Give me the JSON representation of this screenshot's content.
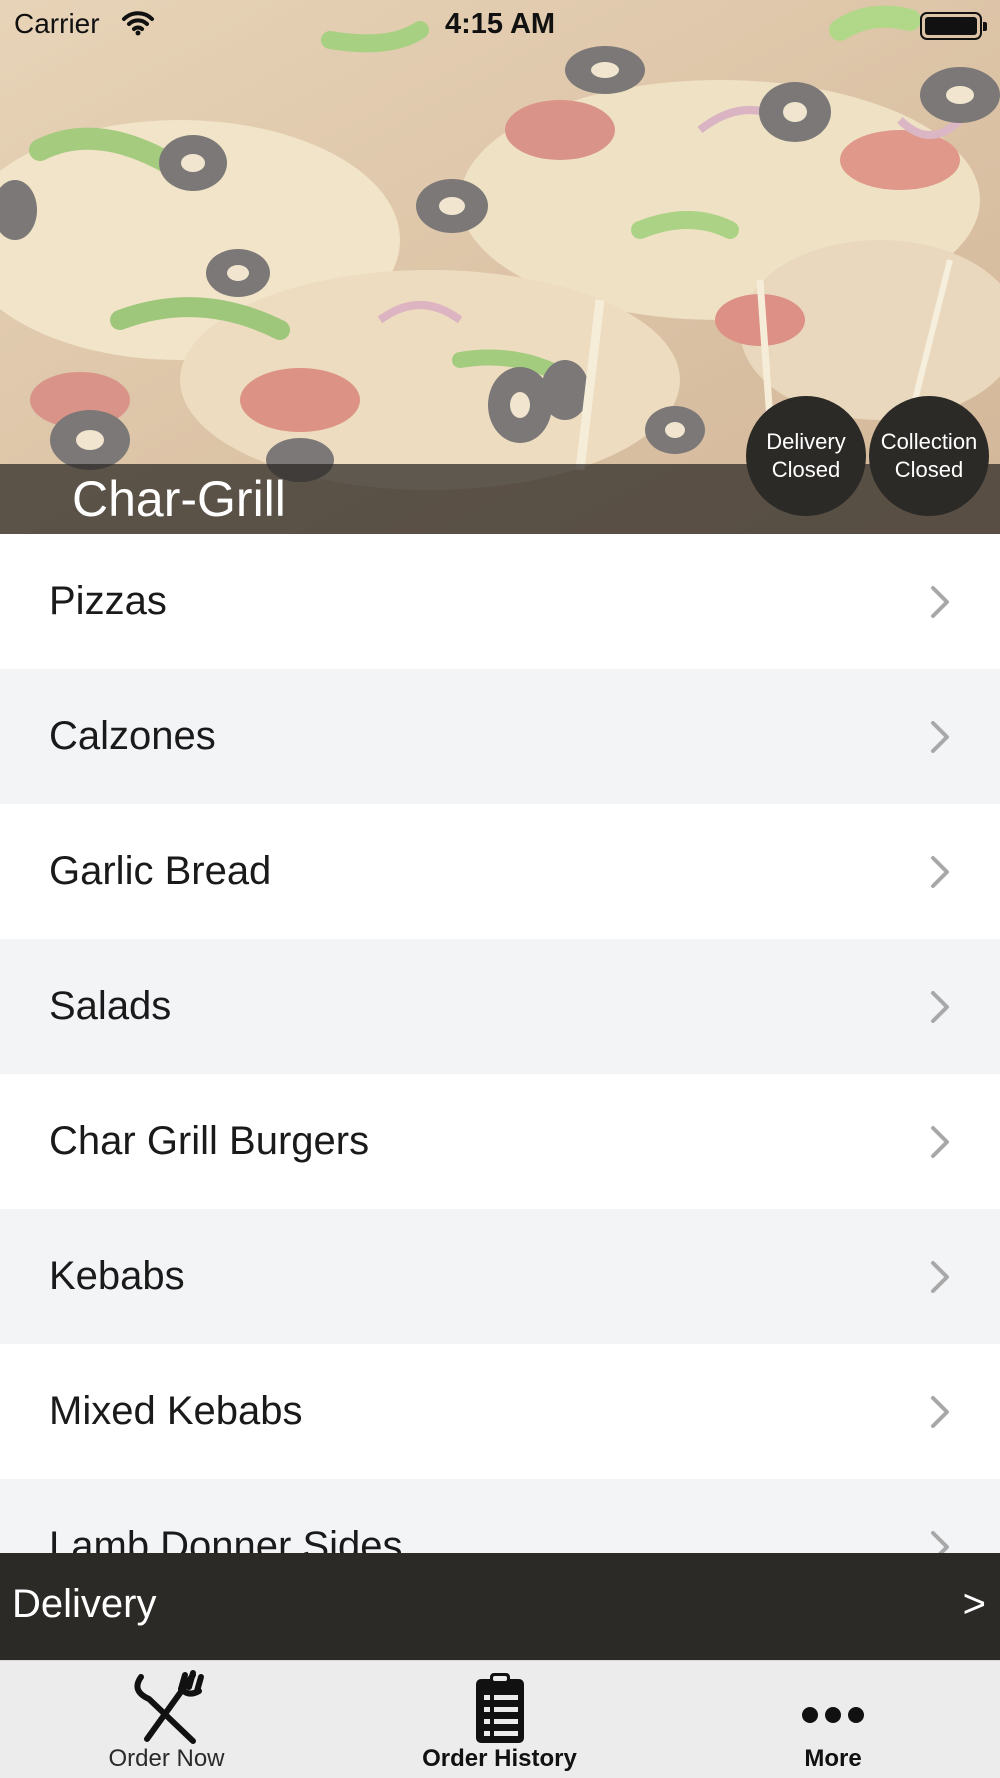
{
  "status_bar": {
    "carrier": "Carrier",
    "time": "4:15 AM"
  },
  "header": {
    "restaurant_name": "Char-Grill",
    "badges": [
      {
        "line1": "Delivery",
        "line2": "Closed"
      },
      {
        "line1": "Collection",
        "line2": "Closed"
      }
    ]
  },
  "menu": {
    "categories": [
      {
        "label": "Pizzas"
      },
      {
        "label": "Calzones"
      },
      {
        "label": "Garlic Bread"
      },
      {
        "label": "Salads"
      },
      {
        "label": "Char Grill Burgers"
      },
      {
        "label": "Kebabs"
      },
      {
        "label": "Mixed Kebabs"
      },
      {
        "label": "Lamb Donner Sides"
      }
    ]
  },
  "order_mode": {
    "label": "Delivery",
    "arrow": ">"
  },
  "tab_bar": {
    "tabs": [
      {
        "label": "Order Now",
        "icon": "fork-knife-icon"
      },
      {
        "label": "Order History",
        "icon": "clipboard-list-icon"
      },
      {
        "label": "More",
        "icon": "more-dots-icon"
      }
    ]
  },
  "colors": {
    "dark_bar": "#2b2a26",
    "row_alt": "#f3f4f6",
    "chevron": "#a8a8a8"
  }
}
